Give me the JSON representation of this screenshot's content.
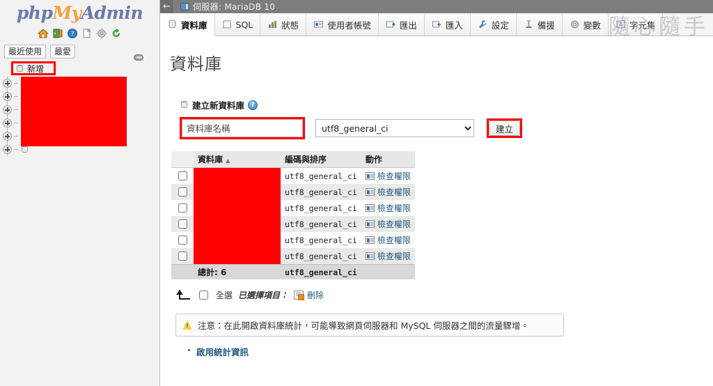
{
  "brand": {
    "php": "php",
    "my": "My",
    "admin": "Admin"
  },
  "sidebar": {
    "icons": [
      {
        "name": "home-icon",
        "glyph": "⌂"
      },
      {
        "name": "logout-icon",
        "glyph": "⬌"
      },
      {
        "name": "help-icon",
        "glyph": "?"
      },
      {
        "name": "documentation-icon",
        "glyph": "❐"
      },
      {
        "name": "settings-icon",
        "glyph": "⚙"
      },
      {
        "name": "reload-icon",
        "glyph": "⟳"
      }
    ],
    "tabs": [
      {
        "label": "最近使用"
      },
      {
        "label": "最愛"
      }
    ],
    "new_db_label": "新增",
    "tree_rows": [
      {
        "expander": "+"
      },
      {
        "expander": "+"
      },
      {
        "expander": "+"
      },
      {
        "expander": "+"
      },
      {
        "expander": "+"
      },
      {
        "expander": "+"
      }
    ],
    "redacted": true
  },
  "topbar": {
    "back_glyph": "←",
    "title": "伺服器: MariaDB 10"
  },
  "tabs": [
    {
      "label": "資料庫",
      "icon": "database-icon",
      "active": true
    },
    {
      "label": "SQL",
      "icon": "sql-icon",
      "active": false
    },
    {
      "label": "狀態",
      "icon": "status-icon",
      "active": false
    },
    {
      "label": "使用者帳號",
      "icon": "users-icon",
      "active": false
    },
    {
      "label": "匯出",
      "icon": "export-icon",
      "active": false
    },
    {
      "label": "匯入",
      "icon": "import-icon",
      "active": false
    },
    {
      "label": "設定",
      "icon": "wrench-icon",
      "active": false
    },
    {
      "label": "備援",
      "icon": "replication-icon",
      "active": false
    },
    {
      "label": "變數",
      "icon": "variables-icon",
      "active": false
    },
    {
      "label": "字元集",
      "icon": "charset-icon",
      "active": false
    }
  ],
  "watermark": "隨心隨手",
  "main": {
    "page_title": "資料庫",
    "create_section": {
      "heading": "建立新資料庫",
      "help_glyph": "?",
      "name_placeholder": "資料庫名稱",
      "name_value": "",
      "collation_value": "utf8_general_ci",
      "collation_options": [
        "utf8_general_ci"
      ],
      "create_button": "建立"
    },
    "table": {
      "headers": [
        "",
        "資料庫",
        "編碼與排序",
        "動作"
      ],
      "sort_indicator": "▲",
      "rows": [
        {
          "checked": false,
          "name": "",
          "collation": "utf8_general_ci",
          "action": "檢查權限"
        },
        {
          "checked": false,
          "name": "",
          "collation": "utf8_general_ci",
          "action": "檢查權限"
        },
        {
          "checked": false,
          "name": "",
          "collation": "utf8_general_ci",
          "action": "檢查權限"
        },
        {
          "checked": false,
          "name": "",
          "collation": "utf8_general_ci",
          "action": "檢查權限"
        },
        {
          "checked": false,
          "name": "",
          "collation": "utf8_general_ci",
          "action": "檢查權限"
        },
        {
          "checked": false,
          "name": "",
          "collation": "utf8_general_ci",
          "action": "檢查權限"
        }
      ],
      "total_label": "總計: 6",
      "total_collation": "utf8_general_ci"
    },
    "with_selected": {
      "check_all_label": "全選",
      "selected_label": "已選擇項目：",
      "drop_label": "刪除"
    },
    "notice": "注意：在此開啟資料庫統計，可能導致網頁伺服器和 MySQL 伺服器之間的流量驟增。",
    "links": [
      {
        "label": "啟用統計資訊"
      }
    ]
  },
  "colors": {
    "redaction": "#ff0000",
    "highlight_box": "#ff0000",
    "topbar_bg": "#7d7d7d",
    "link": "#235a81",
    "brand_blue": "#6c78af",
    "brand_orange": "#f2a13a"
  }
}
